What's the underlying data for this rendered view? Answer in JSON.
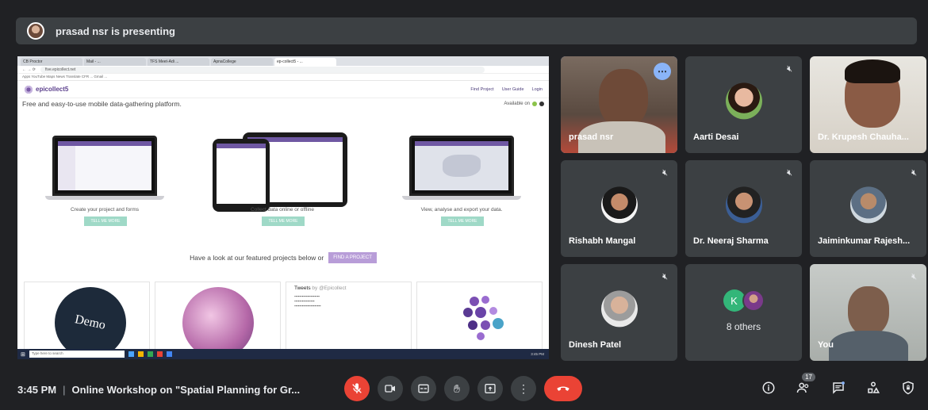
{
  "banner": {
    "text": "prasad nsr is presenting"
  },
  "shared_screen": {
    "browser_tabs": [
      "CB Proctor",
      "Mail - ...",
      "TFS Meet-Adi ...",
      "ApnaCollege",
      "ep-collect5 - ...",
      ""
    ],
    "url": "five.epicollect.net",
    "bookmarks": "Apps  YouTube  Maps  News  Translate  CFR  ...  Gmail  ...",
    "site": {
      "logo": "epicollect5",
      "nav": [
        "Find Project",
        "User Guide",
        "Login"
      ],
      "tagline": "Free and easy-to-use mobile data-gathering platform.",
      "available_on": "Available on",
      "features": [
        {
          "caption": "Create your project and forms",
          "button": "TELL ME MORE"
        },
        {
          "caption": "Collect data online or offline",
          "button": "TELL ME MORE"
        },
        {
          "caption": "View, analyse and export your data.",
          "button": "TELL ME MORE"
        }
      ],
      "featured_text": "Have a look at our featured projects below or",
      "find_project_button": "FIND A PROJECT",
      "demo_label": "Demo",
      "tweets_title": "Tweets",
      "tweets_by": "by @Epicollect"
    },
    "taskbar": {
      "search": "Type here to search",
      "clock": "3:45 PM"
    }
  },
  "participants": [
    {
      "name": "prasad nsr"
    },
    {
      "name": "Aarti Desai"
    },
    {
      "name": "Dr. Krupesh Chauha..."
    },
    {
      "name": "Rishabh Mangal"
    },
    {
      "name": "Dr. Neeraj Sharma"
    },
    {
      "name": "Jaiminkumar Rajesh..."
    },
    {
      "name": "Dinesh Patel"
    },
    {
      "name": "8 others",
      "initial": "K"
    },
    {
      "name": "You"
    }
  ],
  "bottombar": {
    "time": "3:45 PM",
    "meeting_title": "Online Workshop on \"Spatial Planning for Gr...",
    "participant_count": "17"
  },
  "colors": {
    "bg": "#202124",
    "tile": "#3c4043",
    "red": "#ea4335",
    "accent": "#8ab4f8"
  }
}
